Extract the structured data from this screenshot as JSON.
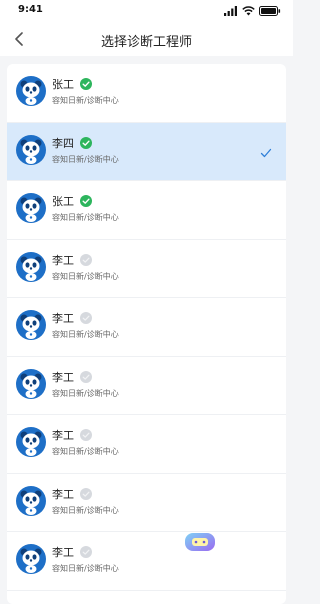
{
  "status_bar": {
    "time": "9:41"
  },
  "header": {
    "title": "选择诊断工程师"
  },
  "engineers": [
    {
      "name": "张工",
      "dept": "容知日新/诊断中心",
      "online": true,
      "selected": false
    },
    {
      "name": "李四",
      "dept": "容知日新/诊断中心",
      "online": true,
      "selected": true
    },
    {
      "name": "张工",
      "dept": "容知日新/诊断中心",
      "online": true,
      "selected": false
    },
    {
      "name": "李工",
      "dept": "容知日新/诊断中心",
      "online": false,
      "selected": false
    },
    {
      "name": "李工",
      "dept": "容知日新/诊断中心",
      "online": false,
      "selected": false
    },
    {
      "name": "李工",
      "dept": "容知日新/诊断中心",
      "online": false,
      "selected": false
    },
    {
      "name": "李工",
      "dept": "容知日新/诊断中心",
      "online": false,
      "selected": false
    },
    {
      "name": "李工",
      "dept": "容知日新/诊断中心",
      "online": false,
      "selected": false
    },
    {
      "name": "李工",
      "dept": "容知日新/诊断中心",
      "online": false,
      "selected": false
    }
  ],
  "colors": {
    "accent": "#2f7fd8",
    "selected_bg": "#d8e9fb",
    "online": "#2db55d",
    "offline": "#d6d9de"
  }
}
